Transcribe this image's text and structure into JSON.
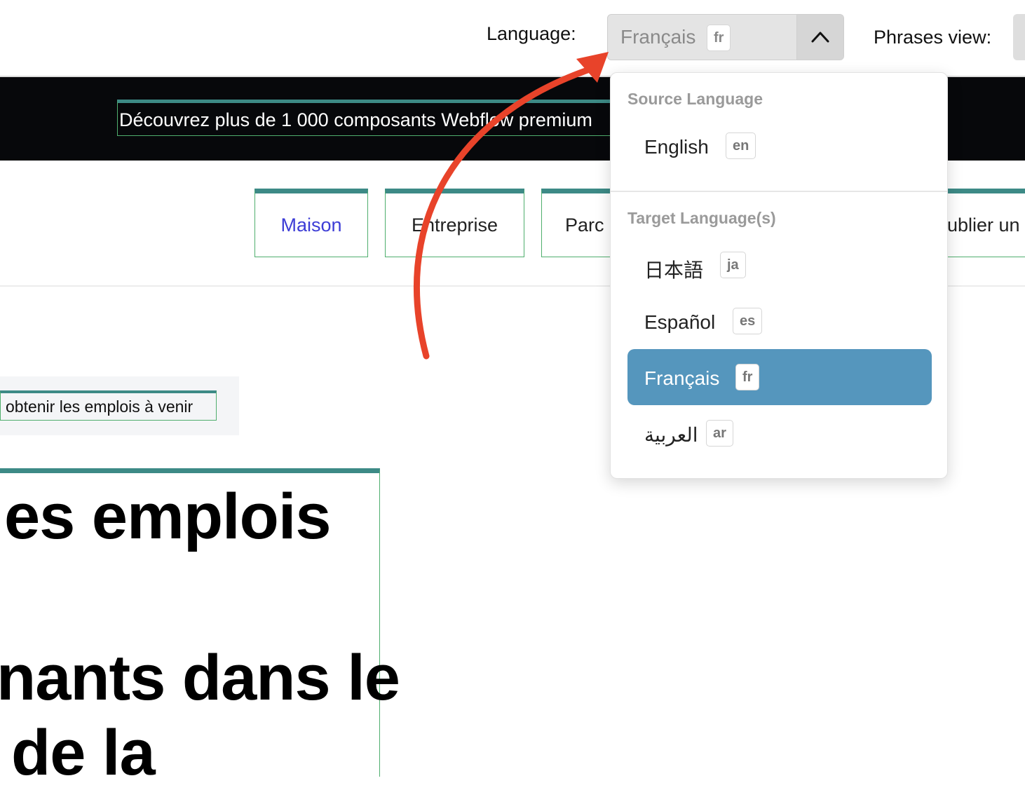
{
  "toolbar": {
    "language_label": "Language:",
    "selected_language": "Français",
    "selected_code": "fr",
    "phrases_label": "Phrases view:"
  },
  "banner": {
    "text": "Découvrez plus de 1 000 composants Webflow premium"
  },
  "nav": {
    "items": [
      "Maison",
      "Entreprise",
      "Parc",
      "ublier un"
    ]
  },
  "hero": {
    "tagline": "obtenir les emplois à venir",
    "heading_lines": [
      "es emplois",
      "nants dans le",
      "de la"
    ]
  },
  "dropdown": {
    "source_title": "Source Language",
    "source_options": [
      {
        "label": "English",
        "code": "en"
      }
    ],
    "target_title": "Target Language(s)",
    "target_options": [
      {
        "label": "日本語",
        "code": "ja"
      },
      {
        "label": "Español",
        "code": "es"
      },
      {
        "label": "Français",
        "code": "fr",
        "selected": true
      },
      {
        "label": "العربية",
        "code": "ar"
      }
    ]
  },
  "colors": {
    "accent_arrow": "#e8432a",
    "selected_option": "#5596bd",
    "banner_bg": "#07080b",
    "outline_green": "#4fae6d",
    "outline_teal": "#3d8a86",
    "nav_active": "#3d3dd6"
  },
  "icons": {
    "select_chevron": "chevron-up-icon",
    "annotation": "curved-arrow-icon"
  }
}
